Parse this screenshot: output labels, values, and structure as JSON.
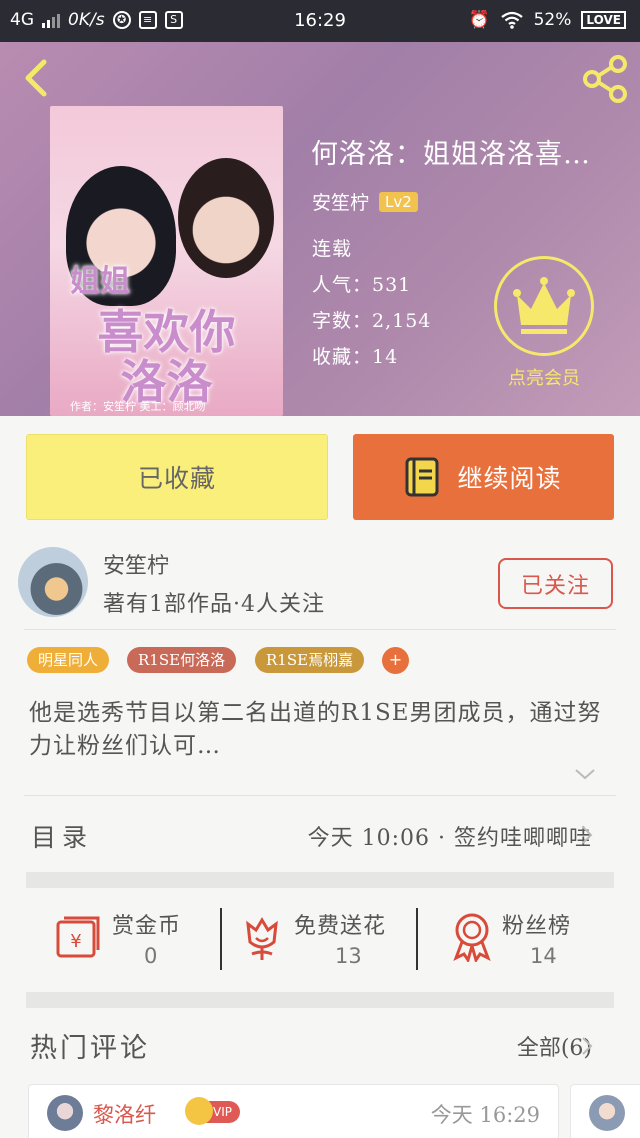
{
  "status_bar": {
    "network": "4G",
    "speed": "0K/s",
    "time": "16:29",
    "battery": "52%",
    "brand_badge": "LOVE"
  },
  "book": {
    "title": "何洛洛：姐姐洛洛喜…",
    "author": "安笙柠",
    "author_level": "Lv2",
    "status": "连载",
    "popularity": "人气：531",
    "word_count": "字数：2,154",
    "favorites": "收藏：14",
    "vip_label": "点亮会员",
    "cover_text": {
      "line1": "姐姐",
      "line2": "喜欢你",
      "line3": "洛洛",
      "credits": "作者：安笙柠    美工：顾北吻"
    }
  },
  "actions": {
    "collect_label": "已收藏",
    "read_label": "继续阅读"
  },
  "author_card": {
    "name": "安笙柠",
    "info": "著有1部作品·4人关注",
    "follow_label": "已关注"
  },
  "tags": [
    "明星同人",
    "R1SE何洛洛",
    "R1SE焉栩嘉"
  ],
  "tag_add": "+",
  "description": "他是选秀节目以第二名出道的R1SE男团成员，通过努力让粉丝们认可…",
  "catalog": {
    "label": "目录",
    "latest": "今天 10:06 · 签约哇唧唧哇"
  },
  "stats": [
    {
      "label": "赏金币",
      "value": "0",
      "icon": "red-envelope-icon"
    },
    {
      "label": "免费送花",
      "value": "13",
      "icon": "flower-icon"
    },
    {
      "label": "粉丝榜",
      "value": "14",
      "icon": "medal-icon"
    }
  ],
  "comments_section": {
    "title": "热门评论",
    "all_label": "全部(6)",
    "comments": [
      {
        "user": "黎洛纤",
        "badge": "VIP",
        "time": "今天 16:29"
      }
    ]
  },
  "colors": {
    "accent_orange": "#e8703c",
    "collect_yellow": "#fbef7b",
    "follow_red": "#d9574c",
    "vip_yellow": "#f5e86b"
  }
}
